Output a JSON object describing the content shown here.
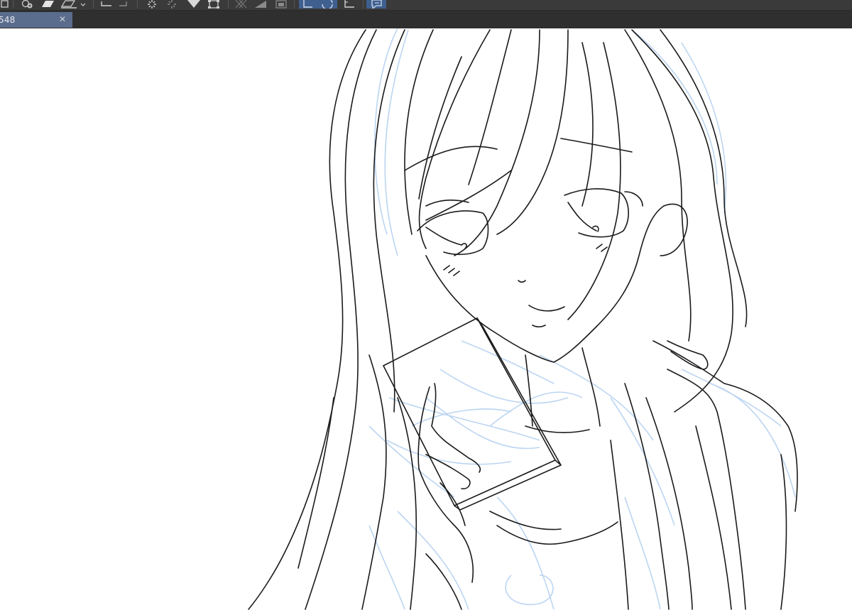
{
  "tab": {
    "label": "548",
    "close_glyph": "✕"
  },
  "colors": {
    "toolbar": "#3a3a3a",
    "tab_active": "#5b6d8c",
    "tool_active": "#3f5f8f",
    "line_art": "#1a1a1a",
    "sketch": "#b9d4f3"
  },
  "toolbar": {
    "icons": [
      "layer-icon",
      "add-layer-icon",
      "fill-icon",
      "stroke-icon",
      "undo-icon",
      "redo-icon",
      "loading-icon",
      "settings-icon",
      "pen-icon",
      "transform-icon",
      "grid-icon",
      "ruler-icon",
      "layer-mask-icon",
      "lasso-icon",
      "circle-select-icon",
      "corner-ruler-icon",
      "speech-bubble-icon"
    ]
  }
}
